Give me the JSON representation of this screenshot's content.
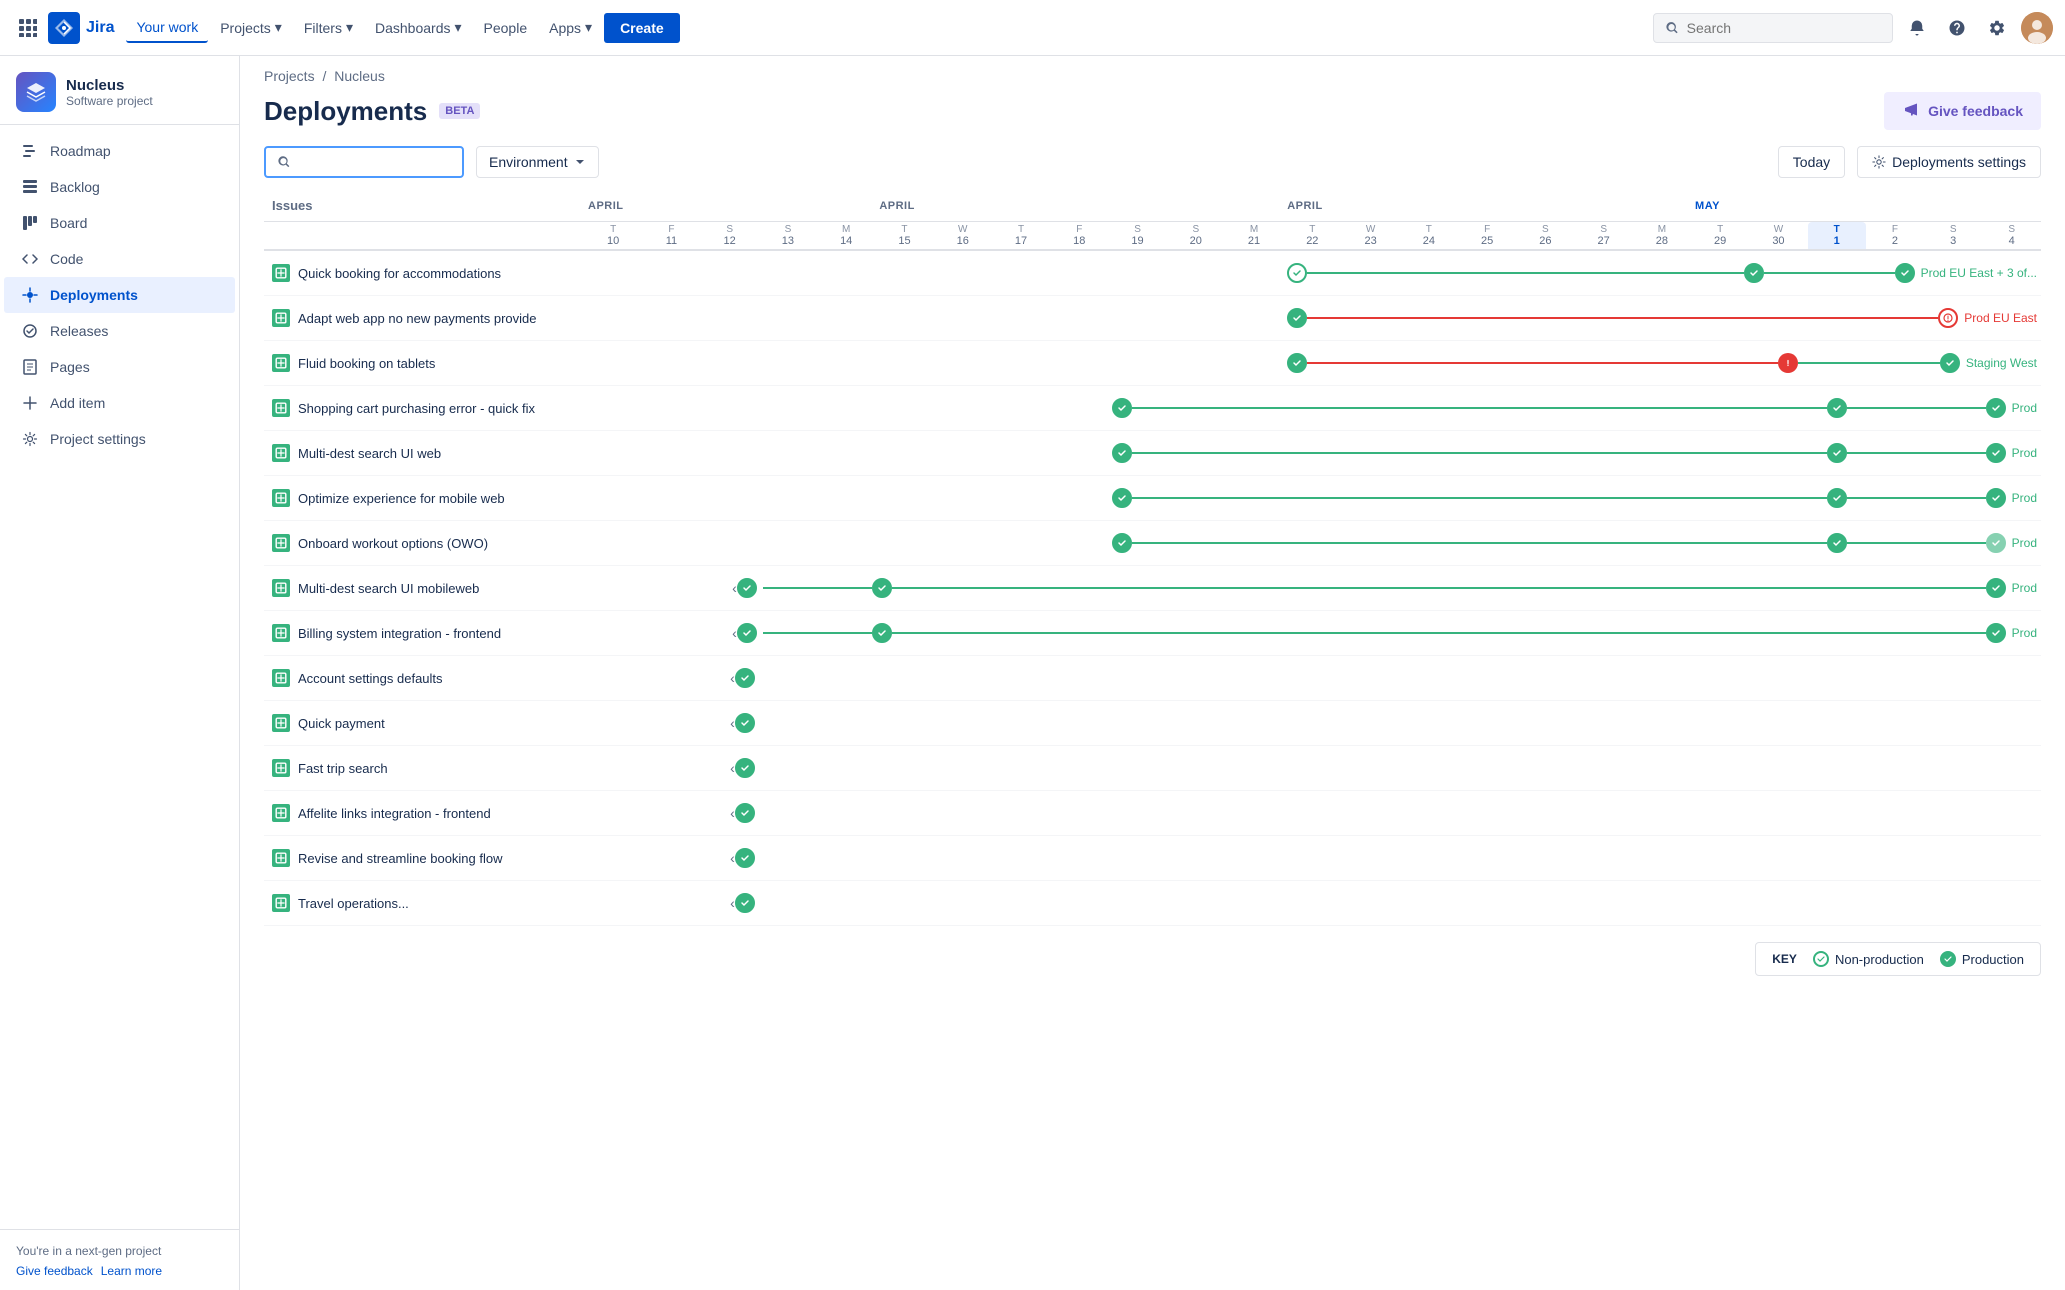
{
  "topnav": {
    "logo_text": "Jira",
    "nav_items": [
      {
        "label": "Your work",
        "active": true
      },
      {
        "label": "Projects",
        "has_arrow": true
      },
      {
        "label": "Filters",
        "has_arrow": true
      },
      {
        "label": "Dashboards",
        "has_arrow": true
      },
      {
        "label": "People"
      },
      {
        "label": "Apps",
        "has_arrow": true
      }
    ],
    "create_label": "Create",
    "search_placeholder": "Search"
  },
  "sidebar": {
    "project_name": "Nucleus",
    "project_type": "Software project",
    "nav_items": [
      {
        "label": "Roadmap",
        "icon": "roadmap"
      },
      {
        "label": "Backlog",
        "icon": "backlog"
      },
      {
        "label": "Board",
        "icon": "board"
      },
      {
        "label": "Code",
        "icon": "code"
      },
      {
        "label": "Deployments",
        "icon": "deployments",
        "active": true
      },
      {
        "label": "Releases",
        "icon": "releases"
      },
      {
        "label": "Pages",
        "icon": "pages"
      },
      {
        "label": "Add item",
        "icon": "add"
      },
      {
        "label": "Project settings",
        "icon": "settings"
      }
    ],
    "footer_text": "You're in a next-gen project",
    "footer_links": [
      "Give feedback",
      "Learn more"
    ]
  },
  "page": {
    "breadcrumb_projects": "Projects",
    "breadcrumb_sep": "/",
    "breadcrumb_project": "Nucleus",
    "title": "Deployments",
    "beta_label": "BETA",
    "give_feedback_label": "Give feedback",
    "search_placeholder": "",
    "env_dropdown_label": "Environment",
    "today_label": "Today",
    "settings_label": "Deployments settings"
  },
  "calendar": {
    "month_groups": [
      {
        "label": "APRIL",
        "col_span": 5,
        "cols": [
          {
            "day": "10",
            "letter": "T"
          },
          {
            "day": "11",
            "letter": "F"
          },
          {
            "day": "12",
            "letter": "S"
          },
          {
            "day": "13",
            "letter": "S"
          },
          {
            "day": "14",
            "letter": "M"
          }
        ]
      },
      {
        "label": "APRIL",
        "col_span": 7,
        "cols": [
          {
            "day": "15",
            "letter": "T"
          },
          {
            "day": "16",
            "letter": "W"
          },
          {
            "day": "17",
            "letter": "T"
          },
          {
            "day": "18",
            "letter": "F"
          },
          {
            "day": "19",
            "letter": "S"
          },
          {
            "day": "20",
            "letter": "S"
          },
          {
            "day": "21",
            "letter": "M"
          }
        ]
      },
      {
        "label": "APRIL",
        "col_span": 7,
        "cols": [
          {
            "day": "22",
            "letter": "T"
          },
          {
            "day": "23",
            "letter": "W"
          },
          {
            "day": "24",
            "letter": "T"
          },
          {
            "day": "25",
            "letter": "F"
          },
          {
            "day": "26",
            "letter": "S"
          },
          {
            "day": "27",
            "letter": "S"
          },
          {
            "day": "28",
            "letter": "M"
          }
        ]
      },
      {
        "label": "MAY",
        "col_span": 4,
        "is_may": true,
        "cols": [
          {
            "day": "29",
            "letter": "T"
          },
          {
            "day": "30",
            "letter": "W"
          },
          {
            "day": "1",
            "letter": "T",
            "today": true
          },
          {
            "day": "2",
            "letter": "F"
          },
          {
            "day": "3",
            "letter": "S"
          },
          {
            "day": "4",
            "letter": "S"
          }
        ]
      }
    ]
  },
  "issues": [
    {
      "name": "Quick booking for accommodations",
      "has_expand": false,
      "deployments": "prod_eu_east_plus3"
    },
    {
      "name": "Adapt web app no new payments provide",
      "has_expand": false,
      "deployments": "prod_eu_east_error"
    },
    {
      "name": "Fluid booking on tablets",
      "has_expand": false,
      "deployments": "staging_west_warning"
    },
    {
      "name": "Shopping cart purchasing error - quick fix",
      "has_expand": false,
      "deployments": "prod_short"
    },
    {
      "name": "Multi-dest search UI web",
      "has_expand": false,
      "deployments": "prod_short"
    },
    {
      "name": "Optimize experience for mobile web",
      "has_expand": false,
      "deployments": "prod_short"
    },
    {
      "name": "Onboard workout options (OWO)",
      "has_expand": false,
      "deployments": "prod_short2"
    },
    {
      "name": "Multi-dest search UI mobileweb",
      "has_expand": true,
      "deployments": "prod_long"
    },
    {
      "name": "Billing system integration - frontend",
      "has_expand": true,
      "deployments": "prod_long"
    },
    {
      "name": "Account settings defaults",
      "has_expand": true,
      "deployments": "check_only"
    },
    {
      "name": "Quick payment",
      "has_expand": true,
      "deployments": "check_only"
    },
    {
      "name": "Fast trip search",
      "has_expand": true,
      "deployments": "check_only"
    },
    {
      "name": "Affelite links integration - frontend",
      "has_expand": true,
      "deployments": "check_only"
    },
    {
      "name": "Revise and streamline booking flow",
      "has_expand": true,
      "deployments": "check_only"
    },
    {
      "name": "Travel operations...",
      "has_expand": true,
      "deployments": "check_only"
    }
  ],
  "legend": {
    "key_label": "KEY",
    "non_production_label": "Non-production",
    "production_label": "Production"
  }
}
